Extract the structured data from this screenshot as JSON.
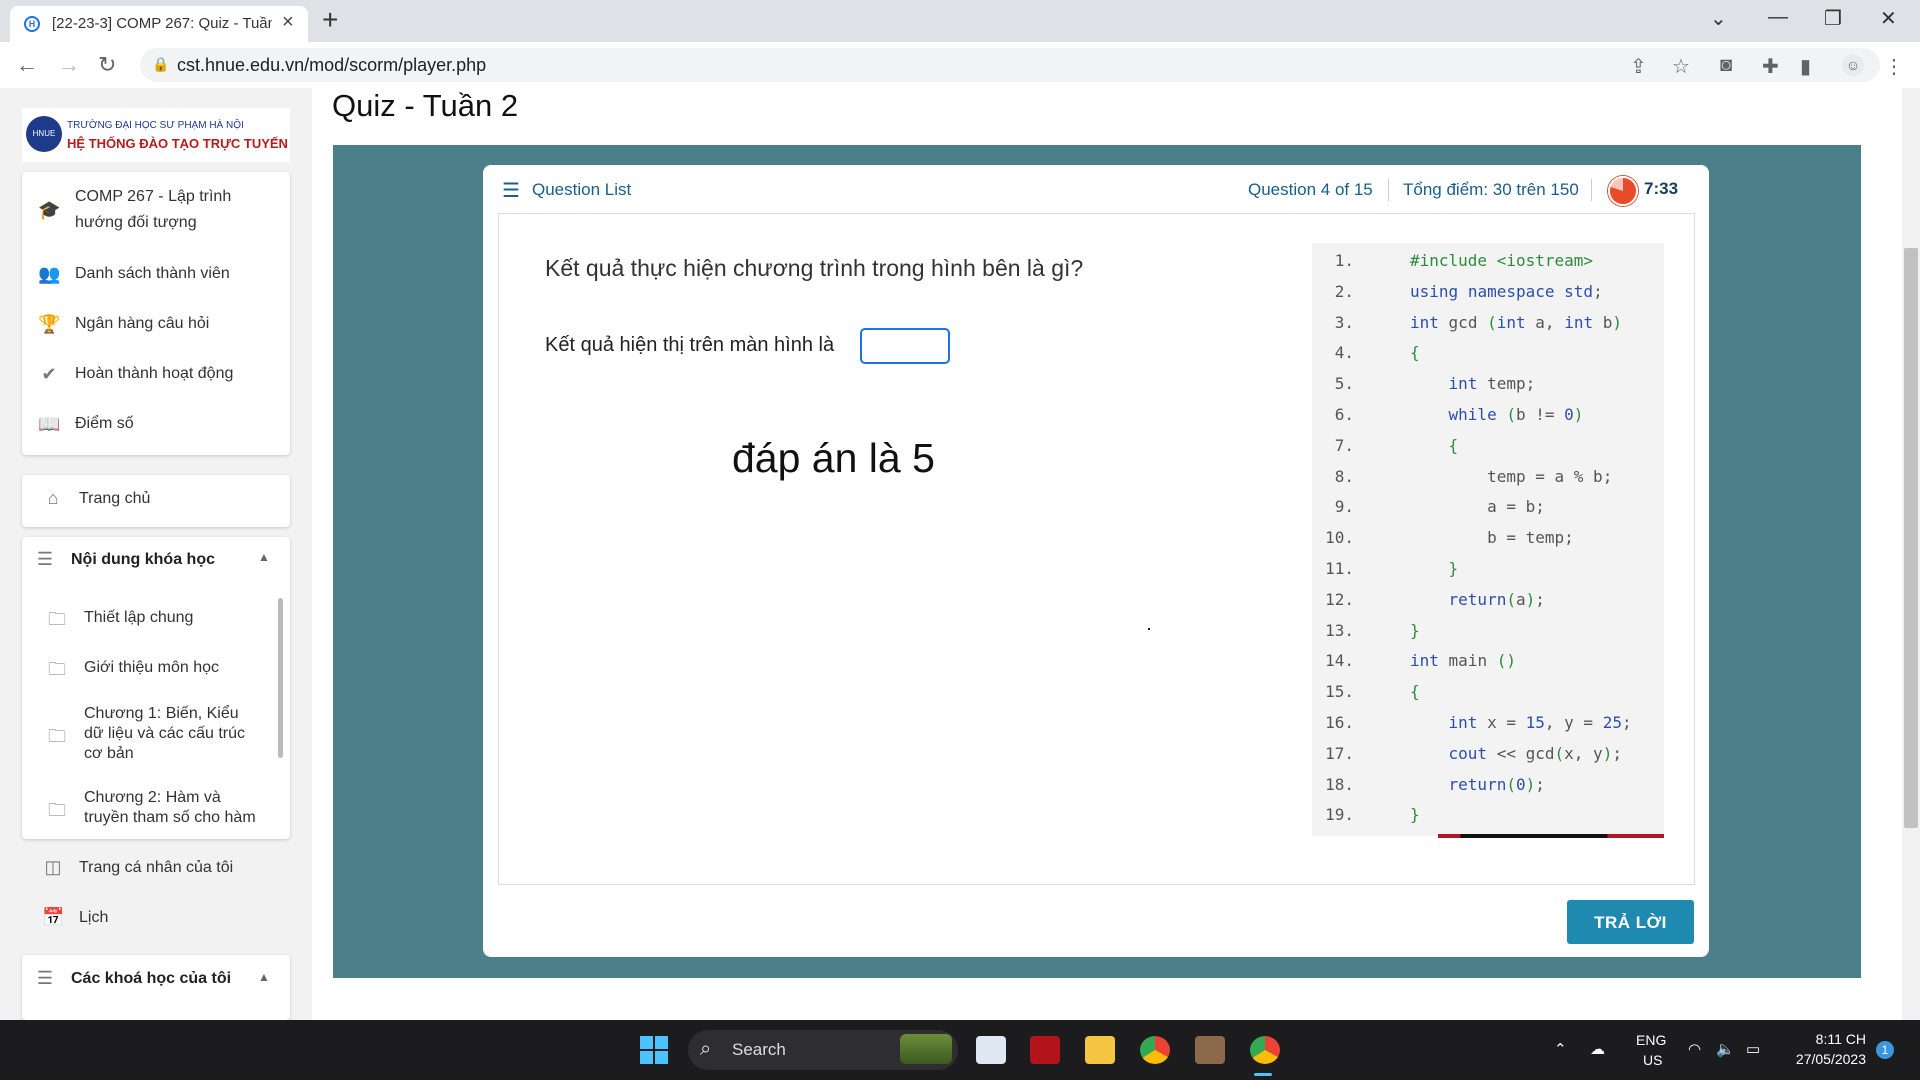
{
  "browser": {
    "tab_title": "[22-23-3] COMP 267: Quiz - Tuần",
    "url": "cst.hnue.edu.vn/mod/scorm/player.php"
  },
  "sidebar": {
    "logo_line1": "TRƯỜNG ĐẠI HỌC SƯ PHẠM HÀ NỘI",
    "logo_line2": "HỆ THỐNG ĐÀO TẠO TRỰC TUYẾN",
    "course_menu": [
      {
        "label_l1": "COMP 267 - Lập trình",
        "label_l2": "hướng đối tượng",
        "icon": "graduation-cap-icon"
      },
      {
        "label": "Danh sách thành viên",
        "icon": "users-icon"
      },
      {
        "label": "Ngân hàng câu hỏi",
        "icon": "trophy-icon"
      },
      {
        "label": "Hoàn thành hoạt động",
        "icon": "check-icon"
      },
      {
        "label": "Điểm số",
        "icon": "book-icon"
      }
    ],
    "home": "Trang chủ",
    "course_content_header": "Nội dung khóa học",
    "course_content": [
      {
        "l1": "Thiết lập chung"
      },
      {
        "l1": "Giới thiệu môn học"
      },
      {
        "l1": "Chương 1: Biến, Kiểu",
        "l2": "dữ liệu và các cấu trúc",
        "l3": "cơ bản"
      },
      {
        "l1": "Chương 2: Hàm và",
        "l2": "truyền tham số cho hàm"
      }
    ],
    "my_page": "Trang cá nhân của tôi",
    "calendar": "Lịch",
    "my_courses_header": "Các khoá học của tôi"
  },
  "page": {
    "title": "Quiz - Tuần 2"
  },
  "quiz": {
    "question_list_label": "Question List",
    "question_number": "Question 4 of 15",
    "score": "Tổng điểm: 30 trên 150",
    "timer": "7:33",
    "question": "Kết quả thực hiện chương trình trong hình bên là gì?",
    "prompt": "Kết quả hiện thị trên màn hình là",
    "answer_value": "",
    "note": "đáp án là 5",
    "submit_label": "TRẢ LỜI",
    "code_lines": [
      "#include <iostream>",
      "using namespace std;",
      "int gcd (int a, int b)",
      "{",
      "    int temp;",
      "    while (b != 0)",
      "    {",
      "        temp = a % b;",
      "        a = b;",
      "        b = temp;",
      "    }",
      "    return(a);",
      "}",
      "int main ()",
      "{",
      "    int x = 15, y = 25;",
      "    cout << gcd(x, y);",
      "    return(0);",
      "}"
    ]
  },
  "taskbar": {
    "search_label": "Search",
    "lang_line1": "ENG",
    "lang_line2": "US",
    "time": "8:11 CH",
    "date": "27/05/2023",
    "notification_count": "1"
  },
  "colors": {
    "quiz_background": "#4b7f89",
    "accent_blue": "#1a5f8a",
    "submit_button": "#1f8ab0"
  }
}
